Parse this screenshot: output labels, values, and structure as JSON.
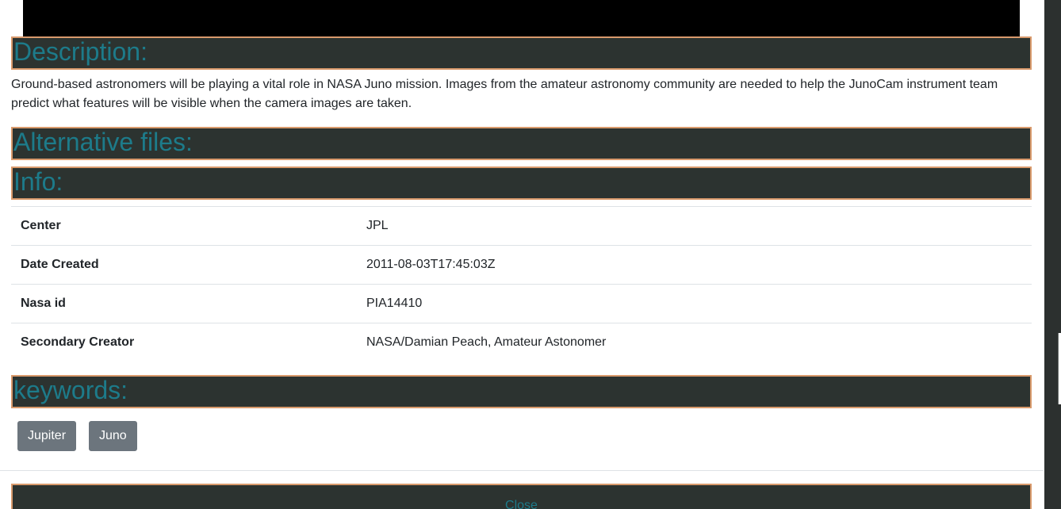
{
  "sections": {
    "description_title": "Description:",
    "alternative_files_title": "Alternative files:",
    "info_title": "Info:",
    "keywords_title": "keywords:"
  },
  "description": {
    "text": "Ground-based astronomers will be playing a vital role in NASA Juno mission. Images from the amateur astronomy community are needed to help the JunoCam instrument team predict what features will be visible when the camera images are taken."
  },
  "info": {
    "rows": [
      {
        "key": "Center",
        "value": "JPL"
      },
      {
        "key": "Date Created",
        "value": "2011-08-03T17:45:03Z"
      },
      {
        "key": "Nasa id",
        "value": "PIA14410"
      },
      {
        "key": "Secondary Creator",
        "value": "NASA/Damian Peach, Amateur Astonomer"
      }
    ]
  },
  "keywords": [
    "Jupiter",
    "Juno"
  ],
  "footer": {
    "close_label": "Close"
  },
  "colors": {
    "header_background": "#2c3330",
    "header_border": "#d99a6c",
    "header_text": "#1d7b8a",
    "tag_background": "#6c757d"
  }
}
